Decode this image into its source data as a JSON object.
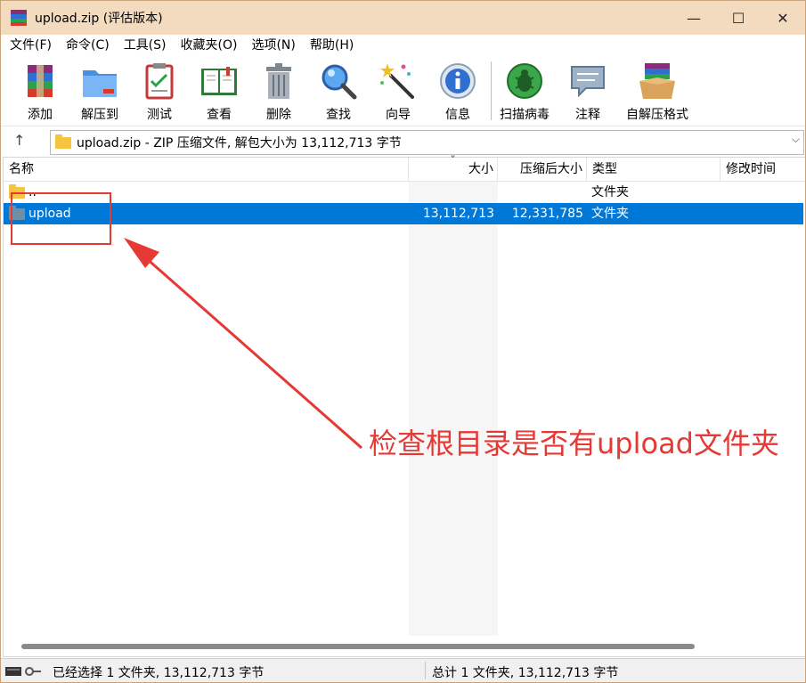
{
  "window": {
    "title": "upload.zip (评估版本)",
    "controls": {
      "minimize": "—",
      "maximize": "☐",
      "close": "✕"
    }
  },
  "menu": [
    "文件(F)",
    "命令(C)",
    "工具(S)",
    "收藏夹(O)",
    "选项(N)",
    "帮助(H)"
  ],
  "toolbar": [
    {
      "label": "添加",
      "icon": "add-archive-icon"
    },
    {
      "label": "解压到",
      "icon": "extract-to-icon"
    },
    {
      "label": "测试",
      "icon": "test-icon"
    },
    {
      "label": "查看",
      "icon": "view-book-icon"
    },
    {
      "label": "删除",
      "icon": "delete-trash-icon"
    },
    {
      "label": "查找",
      "icon": "find-magnifier-icon"
    },
    {
      "label": "向导",
      "icon": "wizard-wand-icon"
    },
    {
      "label": "信息",
      "icon": "info-icon"
    },
    {
      "label": "扫描病毒",
      "icon": "virus-scan-icon"
    },
    {
      "label": "注释",
      "icon": "comment-icon"
    },
    {
      "label": "自解压格式",
      "icon": "sfx-box-icon"
    }
  ],
  "address": {
    "up_glyph": "↑",
    "path": "upload.zip - ZIP 压缩文件, 解包大小为 13,112,713 字节",
    "dropdown_glyph": "⌵"
  },
  "columns": {
    "name": "名称",
    "size": "大小",
    "packed": "压缩后大小",
    "type": "类型",
    "modified": "修改时间",
    "sort_glyph": "ˇ"
  },
  "rows": [
    {
      "name": "..",
      "size": "",
      "packed": "",
      "type": "文件夹",
      "selected": false
    },
    {
      "name": "upload",
      "size": "13,112,713",
      "packed": "12,331,785",
      "type": "文件夹",
      "selected": true
    }
  ],
  "status": {
    "left": "已经选择 1 文件夹, 13,112,713 字节",
    "right": "总计 1 文件夹, 13,112,713 字节"
  },
  "annotation": {
    "text": "检查根目录是否有upload文件夹",
    "color": "#e53935"
  },
  "colors": {
    "titlebar": "#f3dbbf",
    "selection": "#0078d7",
    "folder": "#f5c542"
  }
}
